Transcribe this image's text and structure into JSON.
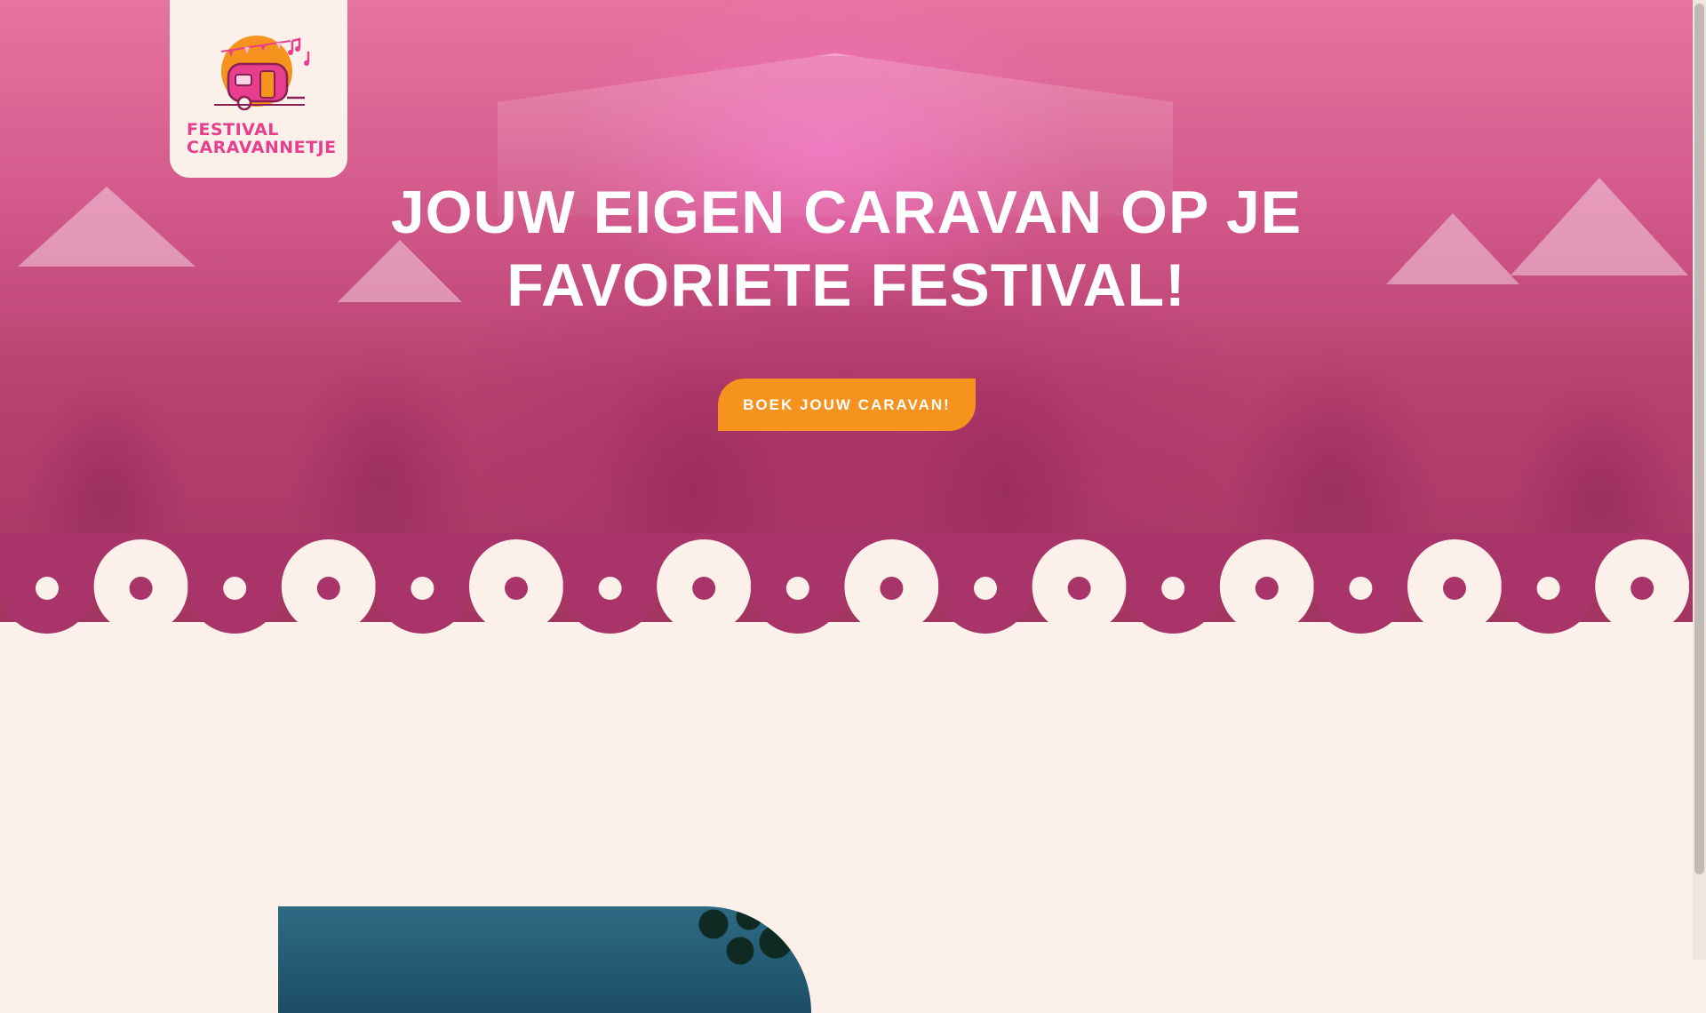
{
  "brand": {
    "line1": "FESTIVAL",
    "line2": "CARAVANNETJE"
  },
  "hero": {
    "headline": "JOUW EIGEN CARAVAN OP JE FAVORIETE FESTIVAL!",
    "cta_label": "BOEK JOUW CARAVAN!"
  },
  "colors": {
    "accent_pink": "#e73f8e",
    "accent_orange": "#f6921e",
    "scallop": "#a8346a",
    "background": "#fbf1ea"
  },
  "icons": [
    "logo-caravan-icon",
    "music-note-icon"
  ]
}
